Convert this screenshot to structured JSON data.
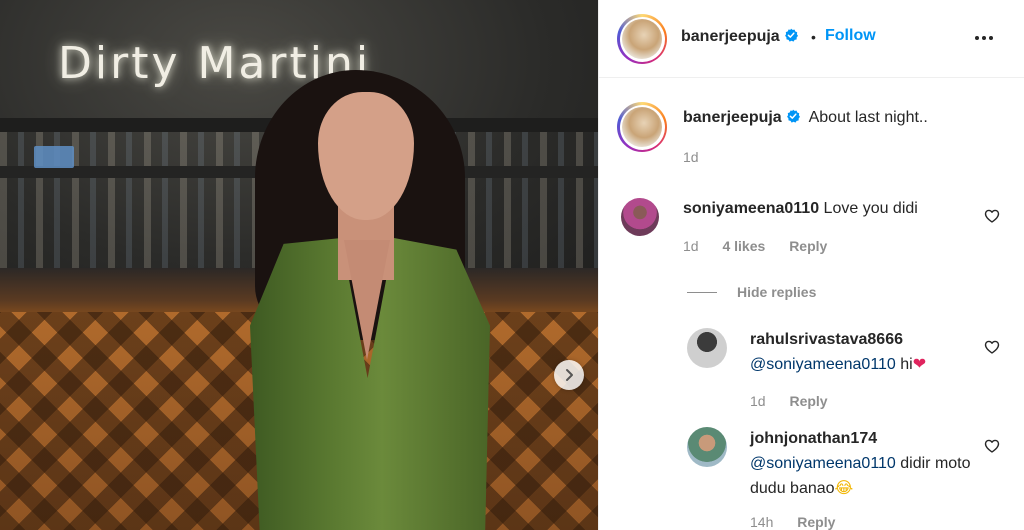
{
  "photo": {
    "sign_text": "Dirty Martini",
    "next_icon": "chevron-right-icon"
  },
  "header": {
    "username": "banerjeepuja",
    "separator": "•",
    "follow_label": "Follow",
    "more_icon": "more-horizontal-icon"
  },
  "caption": {
    "username": "banerjeepuja",
    "text": "About last night..",
    "time": "1d"
  },
  "comments": [
    {
      "username": "soniyameena0110",
      "text": "Love you didi",
      "time": "1d",
      "likes": "4 likes",
      "reply_label": "Reply"
    }
  ],
  "replies_toggle": {
    "label": "Hide replies"
  },
  "replies": [
    {
      "username": "rahulsrivastava8666",
      "mention": "@soniyameena0110",
      "text": " hi",
      "emoji": "❤",
      "time": "1d",
      "reply_label": "Reply"
    },
    {
      "username": "johnjonathan174",
      "mention": "@soniyameena0110",
      "text": " didir moto dudu banao",
      "emoji": "😂",
      "time": "14h",
      "reply_label": "Reply"
    }
  ],
  "colors": {
    "accent": "#0095f6",
    "verified": "#0095f6",
    "muted": "#8e8e8e",
    "mention": "#00376b",
    "heart_emoji": "#e0245e"
  }
}
